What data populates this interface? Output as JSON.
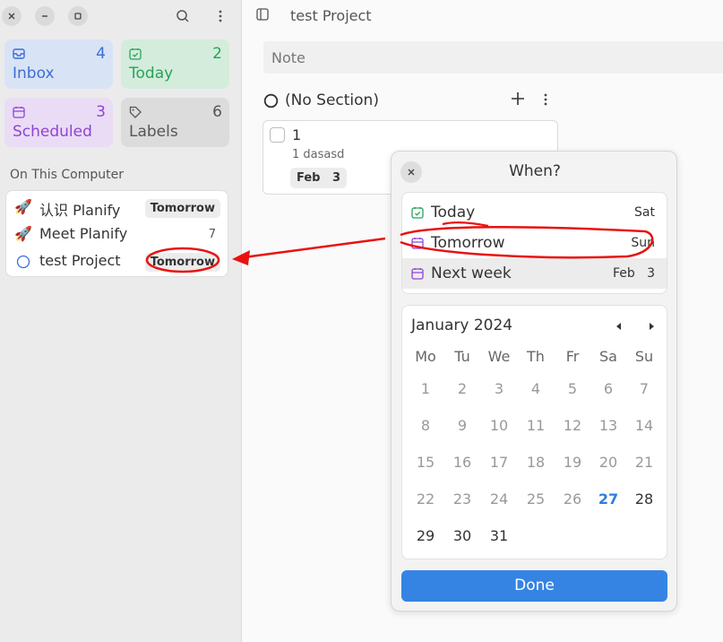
{
  "colors": {
    "inbox": "#3b6fd4",
    "today": "#27a35a",
    "scheduled": "#8e44d6",
    "labels": "#555555",
    "accent": "#3584e4",
    "annotation": "#e8120f"
  },
  "sidebar": {
    "tiles": {
      "inbox": {
        "label": "Inbox",
        "count": "4",
        "icon": "inbox-icon"
      },
      "today": {
        "label": "Today",
        "count": "2",
        "icon": "calendar-check-icon"
      },
      "scheduled": {
        "label": "Scheduled",
        "count": "3",
        "icon": "calendar-icon"
      },
      "labels": {
        "label": "Labels",
        "count": "6",
        "icon": "tag-icon"
      }
    },
    "section_title": "On This Computer",
    "projects": [
      {
        "name": "认识 Planify",
        "icon": "🚀",
        "badge": "Tomorrow"
      },
      {
        "name": "Meet Planify",
        "icon": "🚀",
        "count": "7"
      },
      {
        "name": "test Project",
        "icon": "circle-icon",
        "badge": "Tomorrow"
      }
    ]
  },
  "main": {
    "title": "test Project",
    "note_placeholder": "Note",
    "section": {
      "title": "(No Section)"
    },
    "task": {
      "title": "1",
      "description": "1 dasasd",
      "due": "Feb   3"
    }
  },
  "popover": {
    "title": "When?",
    "quick": [
      {
        "label": "Today",
        "right": "Sat"
      },
      {
        "label": "Tomorrow",
        "right": "Sun"
      },
      {
        "label": "Next week",
        "right": "Feb   3"
      }
    ],
    "calendar": {
      "month": "January 2024",
      "weekdays": [
        "Mo",
        "Tu",
        "We",
        "Th",
        "Fr",
        "Sa",
        "Su"
      ],
      "weeks": [
        [
          "1",
          "2",
          "3",
          "4",
          "5",
          "6",
          "7"
        ],
        [
          "8",
          "9",
          "10",
          "11",
          "12",
          "13",
          "14"
        ],
        [
          "15",
          "16",
          "17",
          "18",
          "19",
          "20",
          "21"
        ],
        [
          "22",
          "23",
          "24",
          "25",
          "26",
          "27",
          "28"
        ],
        [
          "29",
          "30",
          "31"
        ]
      ],
      "today": "27"
    },
    "done_label": "Done"
  }
}
